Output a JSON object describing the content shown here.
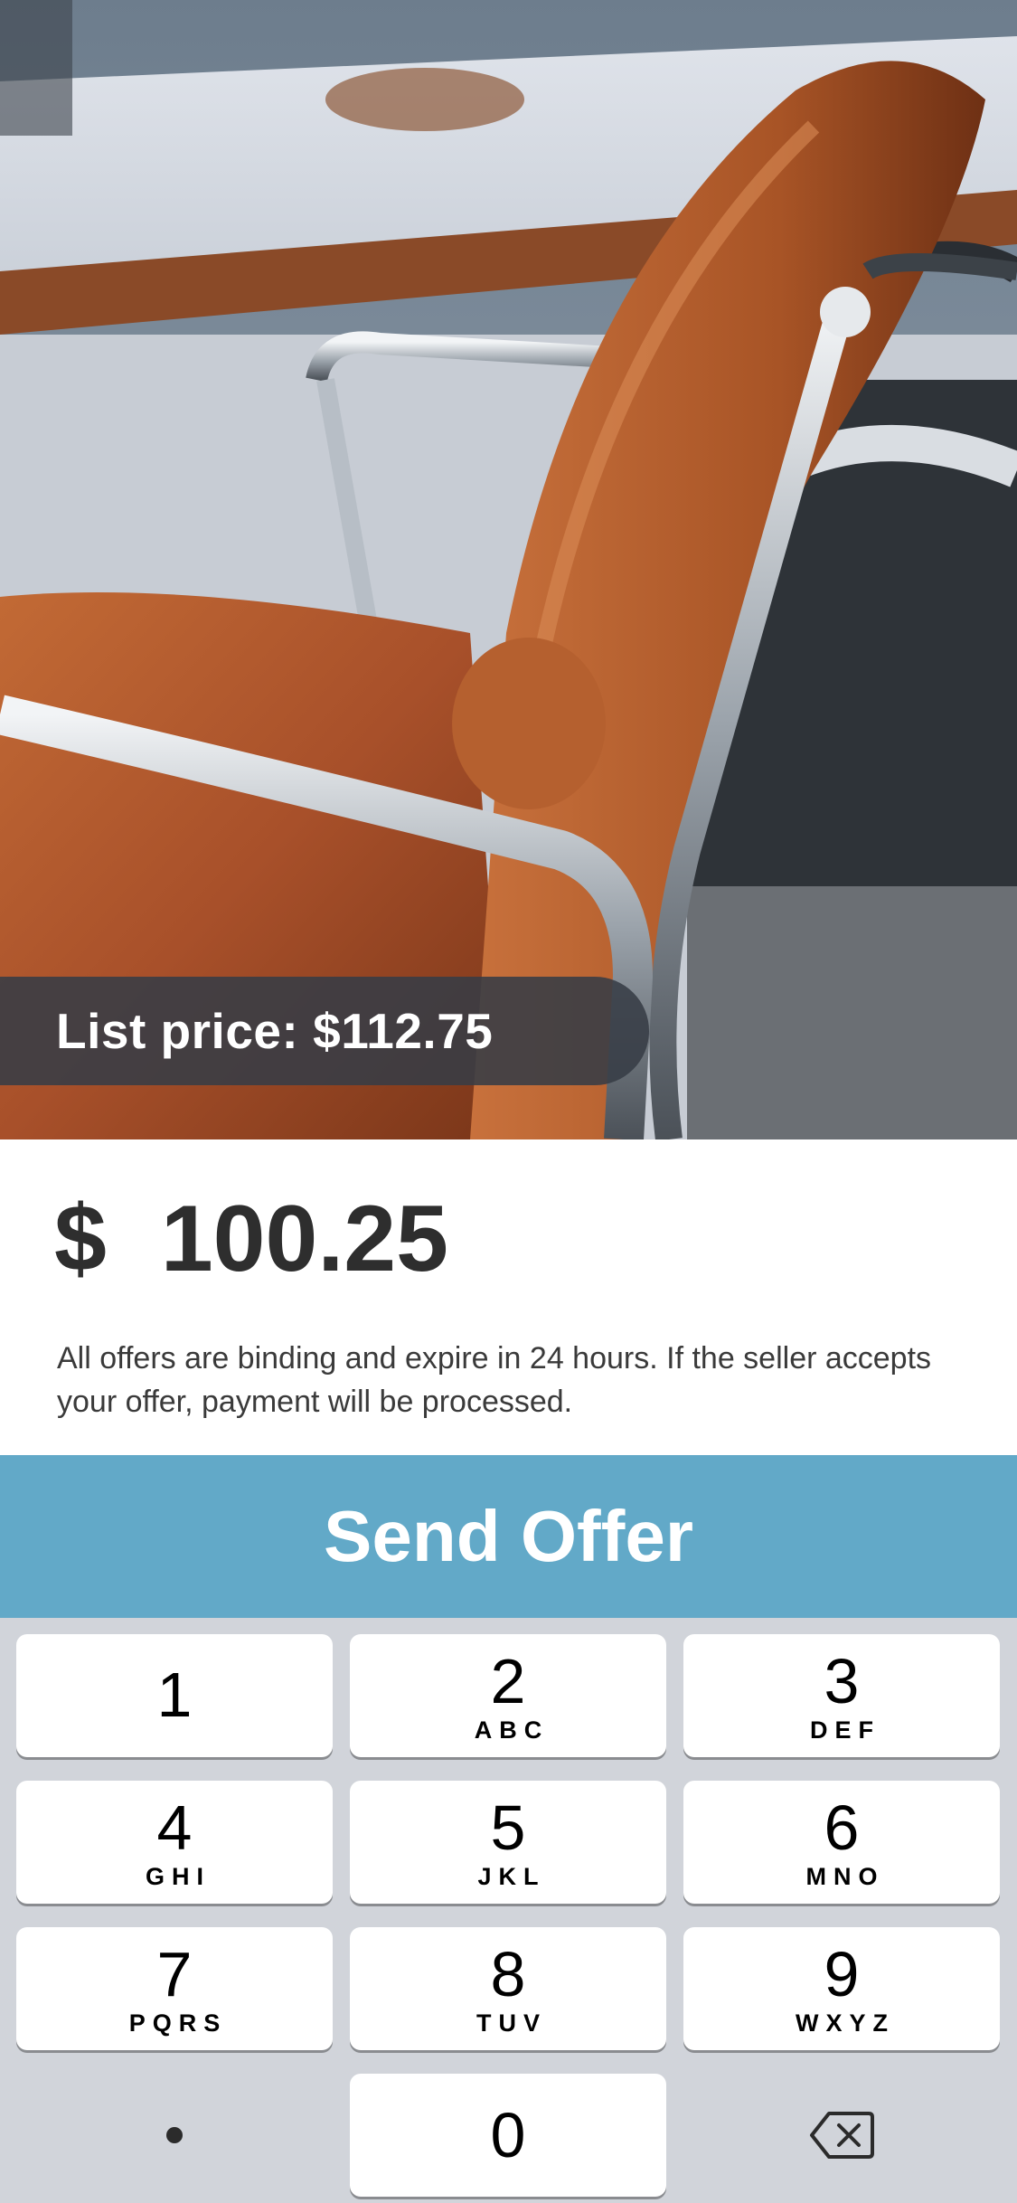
{
  "listing": {
    "list_price_label": "List price: $112.75",
    "photo_icon": "office-chair-photo"
  },
  "offer": {
    "currency_symbol": "$",
    "amount": "100.25",
    "disclaimer": "All offers are binding and expire in 24 hours. If the seller accepts your offer, payment will be processed.",
    "send_label": "Send Offer",
    "accent_color": "#62a9c8"
  },
  "keypad": {
    "keys": [
      {
        "digit": "1",
        "letters": ""
      },
      {
        "digit": "2",
        "letters": "ABC"
      },
      {
        "digit": "3",
        "letters": "DEF"
      },
      {
        "digit": "4",
        "letters": "GHI"
      },
      {
        "digit": "5",
        "letters": "JKL"
      },
      {
        "digit": "6",
        "letters": "MNO"
      },
      {
        "digit": "7",
        "letters": "PQRS"
      },
      {
        "digit": "8",
        "letters": "TUV"
      },
      {
        "digit": "9",
        "letters": "WXYZ"
      },
      {
        "digit": "0",
        "letters": ""
      }
    ],
    "decimal_icon": "decimal-point-icon",
    "delete_icon": "delete-backspace-icon"
  }
}
